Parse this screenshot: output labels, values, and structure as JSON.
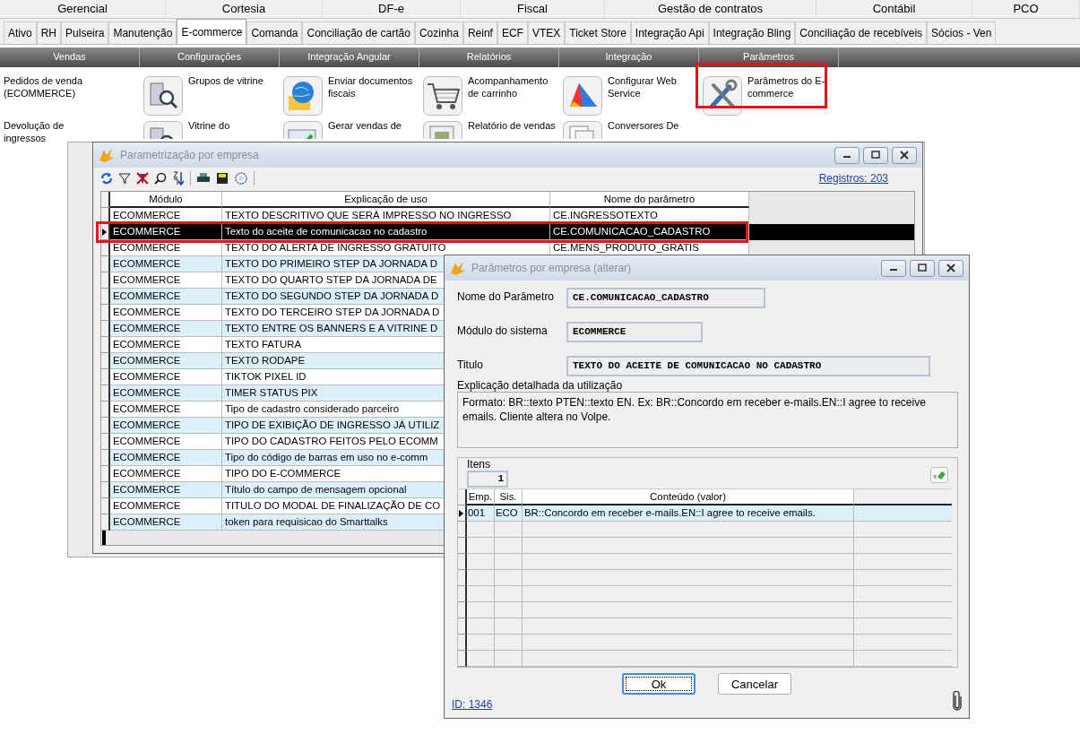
{
  "top_groups": [
    "Gerencial",
    "Cortesia",
    "DF-e",
    "Fiscal",
    "Gestão de contratos",
    "Contábil",
    "PCO"
  ],
  "module_tabs": [
    {
      "label": "Ativo",
      "selected": false
    },
    {
      "label": "RH",
      "selected": false
    },
    {
      "label": "Pulseira",
      "selected": false
    },
    {
      "label": "Manutenção",
      "selected": false
    },
    {
      "label": "E-commerce",
      "selected": true
    },
    {
      "label": "Comanda",
      "selected": false
    },
    {
      "label": "Conciliação de cartão",
      "selected": false
    },
    {
      "label": "Cozinha",
      "selected": false
    },
    {
      "label": "Reinf",
      "selected": false
    },
    {
      "label": "ECF",
      "selected": false
    },
    {
      "label": "VTEX",
      "selected": false
    },
    {
      "label": "Ticket Store",
      "selected": false
    },
    {
      "label": "Integração Api",
      "selected": false
    },
    {
      "label": "Integração Bling",
      "selected": false
    },
    {
      "label": "Conciliação de recebíveis",
      "selected": false
    },
    {
      "label": "Sócios - Ven",
      "selected": false
    }
  ],
  "menu_bar": [
    "Vendas",
    "Configurações",
    "Integração Angular",
    "Relatórios",
    "Integração",
    "Parâmetros"
  ],
  "launcher": [
    {
      "label": "Pedidos de venda (ECOMMERCE)",
      "kind": "text",
      "highlighted": false
    },
    {
      "label": "Grupos de vitrine",
      "kind": "search",
      "highlighted": false
    },
    {
      "label": "Enviar documentos fiscais",
      "kind": "globe",
      "highlighted": false
    },
    {
      "label": "Acompanhamento de carrinho",
      "kind": "cart",
      "highlighted": false
    },
    {
      "label": "Configurar Web Service",
      "kind": "chart",
      "highlighted": false
    },
    {
      "label": "Parâmetros do E-commerce",
      "kind": "tools",
      "highlighted": true
    },
    {
      "label": "Devolução de ingressos",
      "kind": "text",
      "highlighted": false
    },
    {
      "label": "Vitrine do",
      "kind": "search",
      "highlighted": false
    },
    {
      "label": "Gerar vendas de",
      "kind": "check",
      "highlighted": false
    },
    {
      "label": "Relatório de vendas",
      "kind": "report",
      "highlighted": false
    },
    {
      "label": "Conversores De",
      "kind": "doc",
      "highlighted": false
    }
  ],
  "main_window": {
    "title": "Parametrização por empresa",
    "records": "Registros: 203",
    "columns": [
      "Módulo",
      "Explicação de uso",
      "Nome do parâmetro"
    ],
    "rows": [
      {
        "module": "ECOMMERCE",
        "explanation": "TEXTO DESCRITIVO QUE SERÁ IMPRESSO NO INGRESSO",
        "parameter": "CE.INGRESSOTEXTO",
        "selected": false
      },
      {
        "module": "ECOMMERCE",
        "explanation": "Texto do aceite de comunicacao no cadastro",
        "parameter": "CE.COMUNICACAO_CADASTRO",
        "selected": true
      },
      {
        "module": "ECOMMERCE",
        "explanation": "TEXTO DO ALERTA DE INGRESSO GRATUITO",
        "parameter": "CE.MENS_PRODUTO_GRATIS",
        "selected": false
      },
      {
        "module": "ECOMMERCE",
        "explanation": "TEXTO DO PRIMEIRO STEP DA JORNADA D",
        "selected": false
      },
      {
        "module": "ECOMMERCE",
        "explanation": "TEXTO DO QUARTO STEP DA JORNADA DE",
        "selected": false
      },
      {
        "module": "ECOMMERCE",
        "explanation": "TEXTO DO SEGUNDO STEP DA JORNADA D",
        "selected": false
      },
      {
        "module": "ECOMMERCE",
        "explanation": "TEXTO DO TERCEIRO STEP DA JORNADA D",
        "selected": false
      },
      {
        "module": "ECOMMERCE",
        "explanation": "TEXTO ENTRE OS BANNERS E A VITRINE D",
        "selected": false
      },
      {
        "module": "ECOMMERCE",
        "explanation": "TEXTO FATURA",
        "selected": false
      },
      {
        "module": "ECOMMERCE",
        "explanation": "TEXTO RODAPE",
        "selected": false
      },
      {
        "module": "ECOMMERCE",
        "explanation": "TIKTOK PIXEL ID",
        "selected": false
      },
      {
        "module": "ECOMMERCE",
        "explanation": "TIMER STATUS PIX",
        "selected": false
      },
      {
        "module": "ECOMMERCE",
        "explanation": "Tipo de cadastro considerado parceiro",
        "selected": false
      },
      {
        "module": "ECOMMERCE",
        "explanation": "TIPO DE EXIBIÇÃO DE INGRESSO JÁ UTILIZ",
        "selected": false
      },
      {
        "module": "ECOMMERCE",
        "explanation": "TIPO DO CADASTRO FEITOS PELO ECOMM",
        "selected": false
      },
      {
        "module": "ECOMMERCE",
        "explanation": "Tipo do código de barras em uso no e-comm",
        "selected": false
      },
      {
        "module": "ECOMMERCE",
        "explanation": "TIPO DO E-COMMERCE",
        "selected": false
      },
      {
        "module": "ECOMMERCE",
        "explanation": "Título do campo de mensagem opcional",
        "selected": false
      },
      {
        "module": "ECOMMERCE",
        "explanation": "TITULO DO MODAL DE FINALIZAÇÃO DE CO",
        "selected": false
      },
      {
        "module": "ECOMMERCE",
        "explanation": "token para requisicao do Smarttalks",
        "selected": false
      }
    ]
  },
  "dialog": {
    "title": "Parâmetros por empresa (alterar)",
    "fields": [
      {
        "label": "Nome do Parâmetro",
        "value": "CE.COMUNICACAO_CADASTRO"
      },
      {
        "label": "Módulo do sistema",
        "value": "ECOMMERCE"
      },
      {
        "label": "Titulo",
        "value": "TEXTO DO ACEITE DE COMUNICACAO NO CADASTRO"
      }
    ],
    "explanation_label": "Explicação detalhada da utilização",
    "explanation": "Formato: BR::texto PTEN::texto EN. Ex: BR::Concordo em receber e-mails.EN::I agree to receive emails. Cliente altera no Volpe.",
    "items_label": "Itens",
    "items_count": "1",
    "grid_columns": [
      "Emp.",
      "Sis.",
      "Conteúdo (valor)"
    ],
    "grid_rows": [
      {
        "emp": "001",
        "sis": "ECO",
        "content": "BR::Concordo em receber e-mails.EN::I agree to receive emails.",
        "selected": true
      }
    ],
    "buttons": [
      {
        "label": "Ok",
        "focused": true
      },
      {
        "label": "Cancelar",
        "focused": false
      }
    ],
    "id_link": "ID: 1346"
  }
}
